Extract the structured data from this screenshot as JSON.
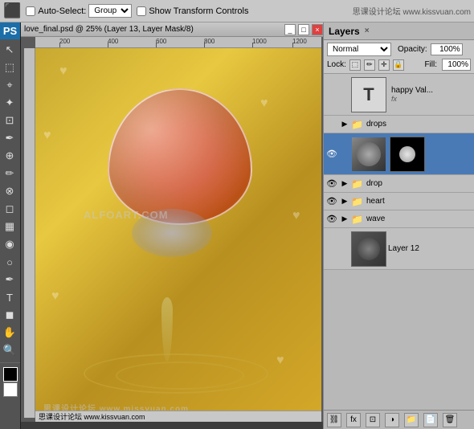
{
  "toolbar": {
    "title": "Photoshop",
    "auto_select_label": "Auto-Select:",
    "auto_select_type": "Group",
    "show_transform_label": "Show Transform Controls",
    "watermark": "ALFOART.COM",
    "watermark2": "思课设计论坛 www.missyuan.com",
    "website_top": "思课设计论坛 www.kissvuan.com"
  },
  "document": {
    "title": "love_final.psd @ 25% (Layer 13, Layer Mask/8)",
    "status": "思课设计论坛 www.kissvuan.com"
  },
  "layers_panel": {
    "title": "Layers",
    "blend_mode": "Normal",
    "opacity_label": "Opacity:",
    "opacity_value": "100%",
    "lock_label": "Lock:",
    "fill_label": "Fill:",
    "fill_value": "100%",
    "layers": [
      {
        "id": "text-layer",
        "name": "happy Val...",
        "type": "text",
        "has_fx": true,
        "fx_label": "fx",
        "visible": true,
        "selected": false
      },
      {
        "id": "drops-group",
        "name": "drops",
        "type": "group",
        "visible": false,
        "selected": false
      },
      {
        "id": "drops-layer",
        "name": "",
        "type": "image",
        "has_mask": true,
        "visible": true,
        "selected": true
      },
      {
        "id": "drop-group",
        "name": "drop",
        "type": "group",
        "visible": true,
        "selected": false
      },
      {
        "id": "heart-group",
        "name": "heart",
        "type": "group",
        "visible": true,
        "selected": false
      },
      {
        "id": "wave-group",
        "name": "wave",
        "type": "group",
        "visible": true,
        "selected": false
      },
      {
        "id": "layer12",
        "name": "Layer 12",
        "type": "image",
        "visible": false,
        "selected": false
      }
    ],
    "footer_icons": [
      "link-icon",
      "fx-icon",
      "mask-icon",
      "folder-icon",
      "delete-icon"
    ]
  },
  "rulers": {
    "h_marks": [
      200,
      400,
      600,
      800,
      1000,
      1200
    ],
    "v_marks": []
  },
  "tools": [
    "move",
    "rectangle-select",
    "lasso",
    "magic-wand",
    "crop",
    "eyedropper",
    "healing",
    "brush",
    "clone-stamp",
    "eraser",
    "gradient",
    "blur",
    "dodge",
    "pen",
    "text",
    "shape",
    "hand",
    "zoom"
  ]
}
